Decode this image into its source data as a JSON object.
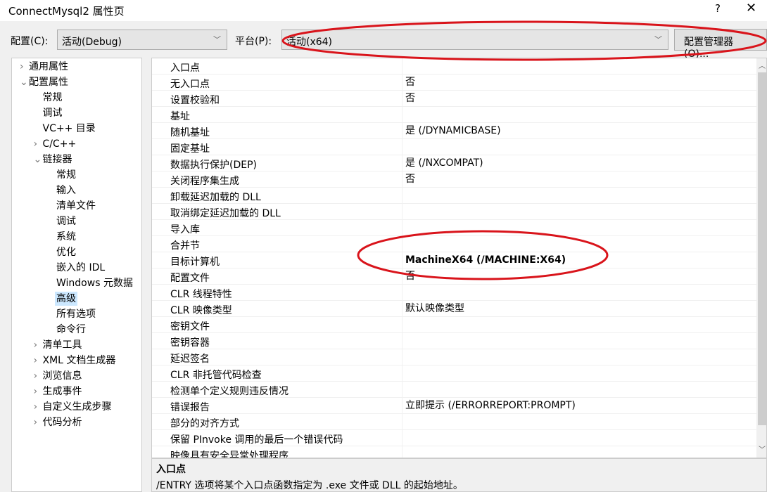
{
  "window": {
    "title": "ConnectMysql2 属性页",
    "help": "?",
    "close": "✕"
  },
  "toolbar": {
    "config_label": "配置(C):",
    "config_value": "活动(Debug)",
    "platform_label": "平台(P):",
    "platform_value": "活动(x64)",
    "manager_button": "配置管理器(O)..."
  },
  "tree": [
    {
      "label": "通用属性",
      "level": 0,
      "arrow": "›"
    },
    {
      "label": "配置属性",
      "level": 0,
      "arrow": "⌄"
    },
    {
      "label": "常规",
      "level": 1
    },
    {
      "label": "调试",
      "level": 1
    },
    {
      "label": "VC++ 目录",
      "level": 1
    },
    {
      "label": "C/C++",
      "level": 1,
      "arrow": "›"
    },
    {
      "label": "链接器",
      "level": 1,
      "arrow": "⌄"
    },
    {
      "label": "常规",
      "level": 2
    },
    {
      "label": "输入",
      "level": 2
    },
    {
      "label": "清单文件",
      "level": 2
    },
    {
      "label": "调试",
      "level": 2
    },
    {
      "label": "系统",
      "level": 2
    },
    {
      "label": "优化",
      "level": 2
    },
    {
      "label": "嵌入的 IDL",
      "level": 2
    },
    {
      "label": "Windows 元数据",
      "level": 2
    },
    {
      "label": "高级",
      "level": 2,
      "selected": true
    },
    {
      "label": "所有选项",
      "level": 2
    },
    {
      "label": "命令行",
      "level": 2
    },
    {
      "label": "清单工具",
      "level": 1,
      "arrow": "›"
    },
    {
      "label": "XML 文档生成器",
      "level": 1,
      "arrow": "›"
    },
    {
      "label": "浏览信息",
      "level": 1,
      "arrow": "›"
    },
    {
      "label": "生成事件",
      "level": 1,
      "arrow": "›"
    },
    {
      "label": "自定义生成步骤",
      "level": 1,
      "arrow": "›"
    },
    {
      "label": "代码分析",
      "level": 1,
      "arrow": "›"
    }
  ],
  "properties": [
    {
      "name": "入口点",
      "value": ""
    },
    {
      "name": "无入口点",
      "value": "否"
    },
    {
      "name": "设置校验和",
      "value": "否"
    },
    {
      "name": "基址",
      "value": ""
    },
    {
      "name": "随机基址",
      "value": "是 (/DYNAMICBASE)"
    },
    {
      "name": "固定基址",
      "value": ""
    },
    {
      "name": "数据执行保护(DEP)",
      "value": "是 (/NXCOMPAT)"
    },
    {
      "name": "关闭程序集生成",
      "value": "否"
    },
    {
      "name": "卸载延迟加载的 DLL",
      "value": ""
    },
    {
      "name": "取消绑定延迟加载的 DLL",
      "value": ""
    },
    {
      "name": "导入库",
      "value": ""
    },
    {
      "name": "合并节",
      "value": ""
    },
    {
      "name": "目标计算机",
      "value": "MachineX64 (/MACHINE:X64)",
      "bold": true
    },
    {
      "name": "配置文件",
      "value": "否"
    },
    {
      "name": "CLR 线程特性",
      "value": ""
    },
    {
      "name": "CLR 映像类型",
      "value": "默认映像类型"
    },
    {
      "name": "密钥文件",
      "value": ""
    },
    {
      "name": "密钥容器",
      "value": ""
    },
    {
      "name": "延迟签名",
      "value": ""
    },
    {
      "name": "CLR 非托管代码检查",
      "value": ""
    },
    {
      "name": "检测单个定义规则违反情况",
      "value": ""
    },
    {
      "name": "错误报告",
      "value": "立即提示 (/ERRORREPORT:PROMPT)"
    },
    {
      "name": "部分的对齐方式",
      "value": ""
    },
    {
      "name": "保留 PInvoke 调用的最后一个错误代码",
      "value": ""
    },
    {
      "name": "映像具有安全异常处理程序",
      "value": ""
    }
  ],
  "description": {
    "title": "入口点",
    "text": "/ENTRY 选项将某个入口点函数指定为 .exe 文件或 DLL 的起始地址。"
  },
  "annotation_color": "#d9141b"
}
